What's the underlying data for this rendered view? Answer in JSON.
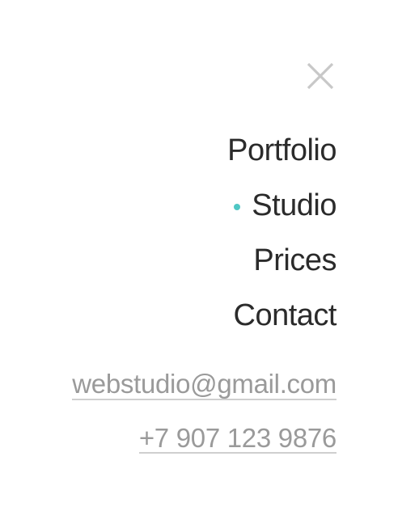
{
  "close": {
    "icon": "close-icon",
    "color": "#c8c8c8"
  },
  "nav": {
    "items": [
      {
        "label": "Portfolio",
        "active": false
      },
      {
        "label": "Studio",
        "active": true
      },
      {
        "label": "Prices",
        "active": false
      },
      {
        "label": "Contact",
        "active": false
      }
    ],
    "active_indicator_color": "#4fc7c4"
  },
  "contacts": {
    "email": "webstudio@gmail.com",
    "phone": "+7 907 123 9876"
  }
}
